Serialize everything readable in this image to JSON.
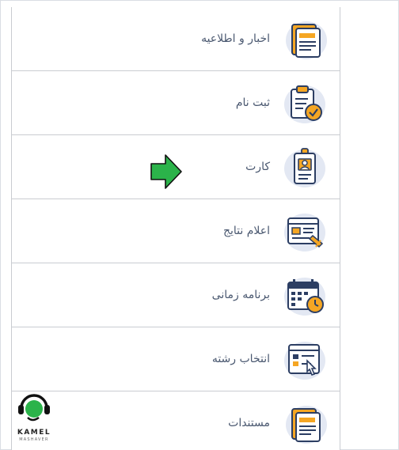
{
  "menu": {
    "items": [
      {
        "label": "اخبار و اطلاعیه",
        "icon": "newspaper-icon"
      },
      {
        "label": "ثبت نام",
        "icon": "clipboard-check-icon"
      },
      {
        "label": "کارت",
        "icon": "id-card-icon"
      },
      {
        "label": "اعلام نتایج",
        "icon": "results-document-icon"
      },
      {
        "label": "برنامه زمانی",
        "icon": "calendar-clock-icon"
      },
      {
        "label": "انتخاب رشته",
        "icon": "field-selection-icon"
      },
      {
        "label": "مستندات",
        "icon": "documents-icon"
      }
    ]
  },
  "pointer": {
    "icon": "green-arrow-icon",
    "color": "#2bb34a"
  },
  "brand": {
    "name": "KAMEL",
    "subtitle": "MASHAVER",
    "logo_icon": "headset-logo-icon",
    "accent": "#2bb34a"
  },
  "colors": {
    "icon_blob": "#e3e8f3",
    "icon_navy": "#2c3e63",
    "icon_orange": "#f5a623",
    "label": "#4a5870",
    "divider": "#c9ccd1"
  }
}
